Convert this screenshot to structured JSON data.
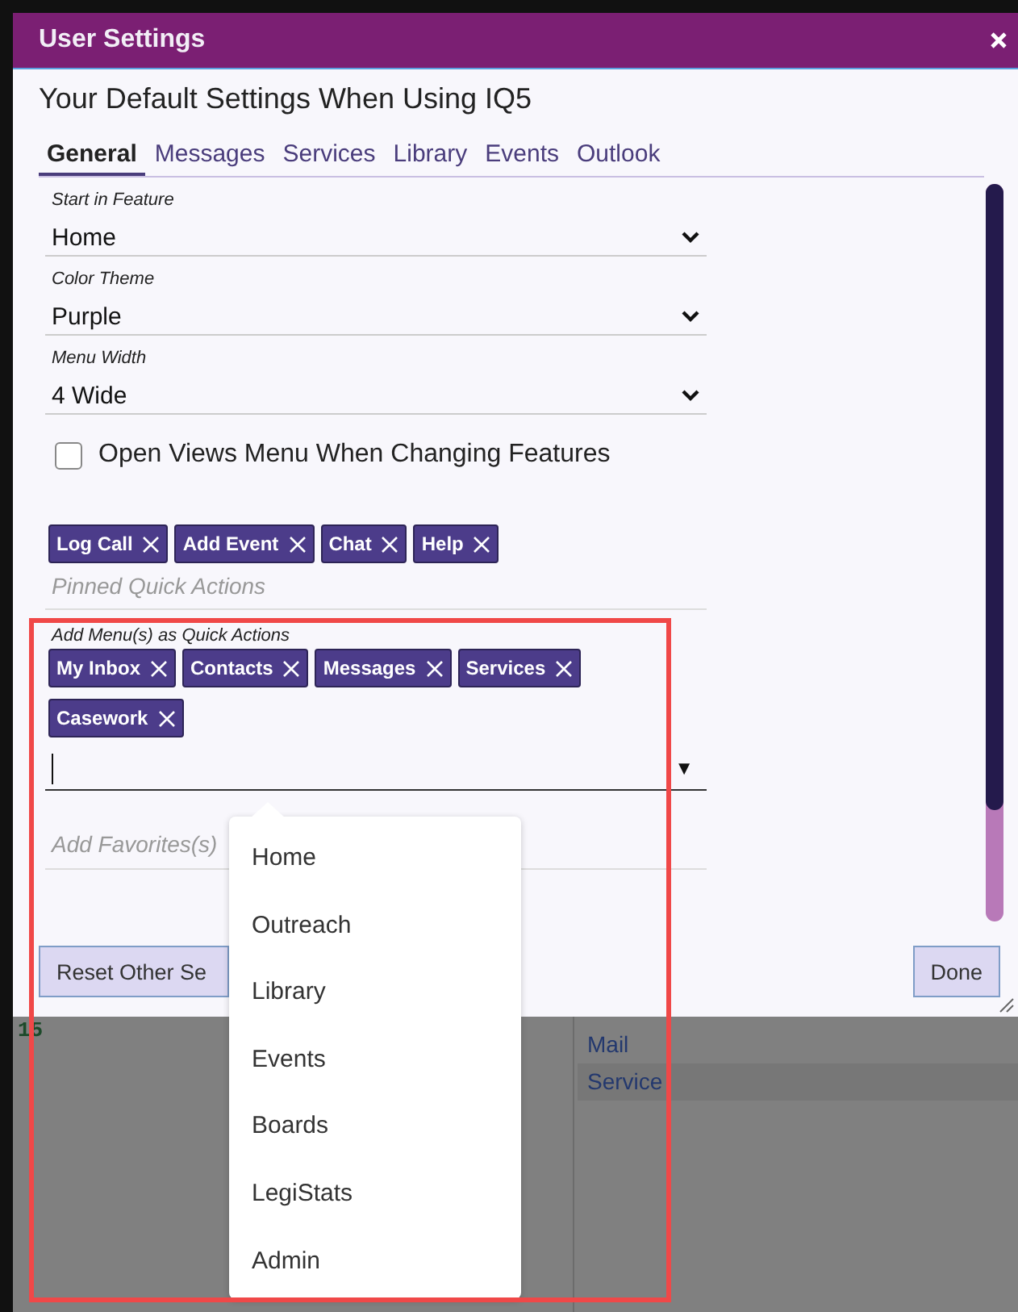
{
  "window": {
    "title": "User Settings"
  },
  "heading": "Your Default Settings When Using IQ5",
  "tabs": [
    {
      "label": "General",
      "selected": true
    },
    {
      "label": "Messages",
      "selected": false
    },
    {
      "label": "Services",
      "selected": false
    },
    {
      "label": "Library",
      "selected": false
    },
    {
      "label": "Events",
      "selected": false
    },
    {
      "label": "Outlook",
      "selected": false
    }
  ],
  "fields": [
    {
      "label": "Start in Feature",
      "value": "Home"
    },
    {
      "label": "Color Theme",
      "value": "Purple"
    },
    {
      "label": "Menu Width",
      "value": "4 Wide"
    }
  ],
  "checkbox": {
    "label": "Open Views Menu When Changing Features",
    "checked": false
  },
  "pinned_quick_actions": {
    "tags": [
      "Log Call",
      "Add Event",
      "Chat",
      "Help"
    ],
    "placeholder": "Pinned Quick Actions"
  },
  "menu_quick_actions": {
    "label": "Add Menu(s) as Quick Actions",
    "tags": [
      "My Inbox",
      "Contacts",
      "Messages",
      "Services",
      "Casework"
    ],
    "arrow": "▼"
  },
  "favorites": {
    "placeholder": "Add Favorites(s)"
  },
  "buttons": [
    {
      "label": "Reset Other Se"
    },
    {
      "label": "Done"
    }
  ],
  "dropdown": {
    "items": [
      "Home",
      "Outreach",
      "Library",
      "Events",
      "Boards",
      "LegiStats",
      "Admin"
    ]
  },
  "background": {
    "number": "15",
    "links": [
      "Mail",
      "Service"
    ]
  }
}
